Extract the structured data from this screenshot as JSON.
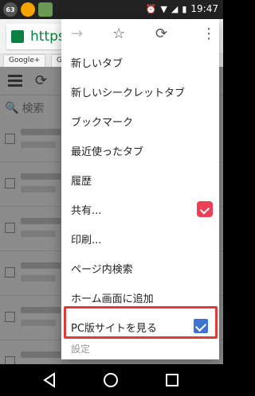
{
  "status_bar": {
    "badges": [
      "63",
      "",
      ""
    ],
    "time": "19:47"
  },
  "browser": {
    "url": "https://",
    "tabs": [
      "Google+",
      "G"
    ]
  },
  "menu": {
    "items": [
      "新しいタブ",
      "新しいシークレットタブ",
      "ブックマーク",
      "最近使ったタブ",
      "履歴",
      "共有...",
      "印刷...",
      "ページ内検索",
      "ホーム画面に追加",
      "PC版サイトを見る"
    ],
    "partial_item": "設定",
    "checked": true
  },
  "page": {
    "search_placeholder": "検索"
  },
  "colors": {
    "highlight": "#e53935",
    "check": "#3f73d1"
  }
}
